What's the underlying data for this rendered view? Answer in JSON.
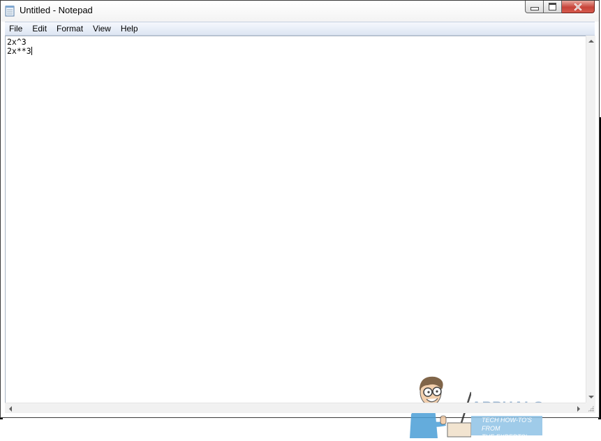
{
  "window": {
    "title": "Untitled - Notepad",
    "icon": "notepad-icon",
    "controls": [
      "minimize-icon",
      "maximize-icon",
      "close-icon"
    ]
  },
  "menu": {
    "items": [
      "File",
      "Edit",
      "Format",
      "View",
      "Help"
    ]
  },
  "editor": {
    "lines": [
      "2x^3",
      "2x**3"
    ]
  },
  "watermark": {
    "brand": "APPUALS",
    "tagline_1": "TECH HOW-TO'S FROM",
    "tagline_2": "THE EXPERTS!"
  },
  "colors": {
    "menubar": "#dde6f3",
    "close_button": "#c7443a",
    "watermark_blue": "#8fc3e6"
  }
}
